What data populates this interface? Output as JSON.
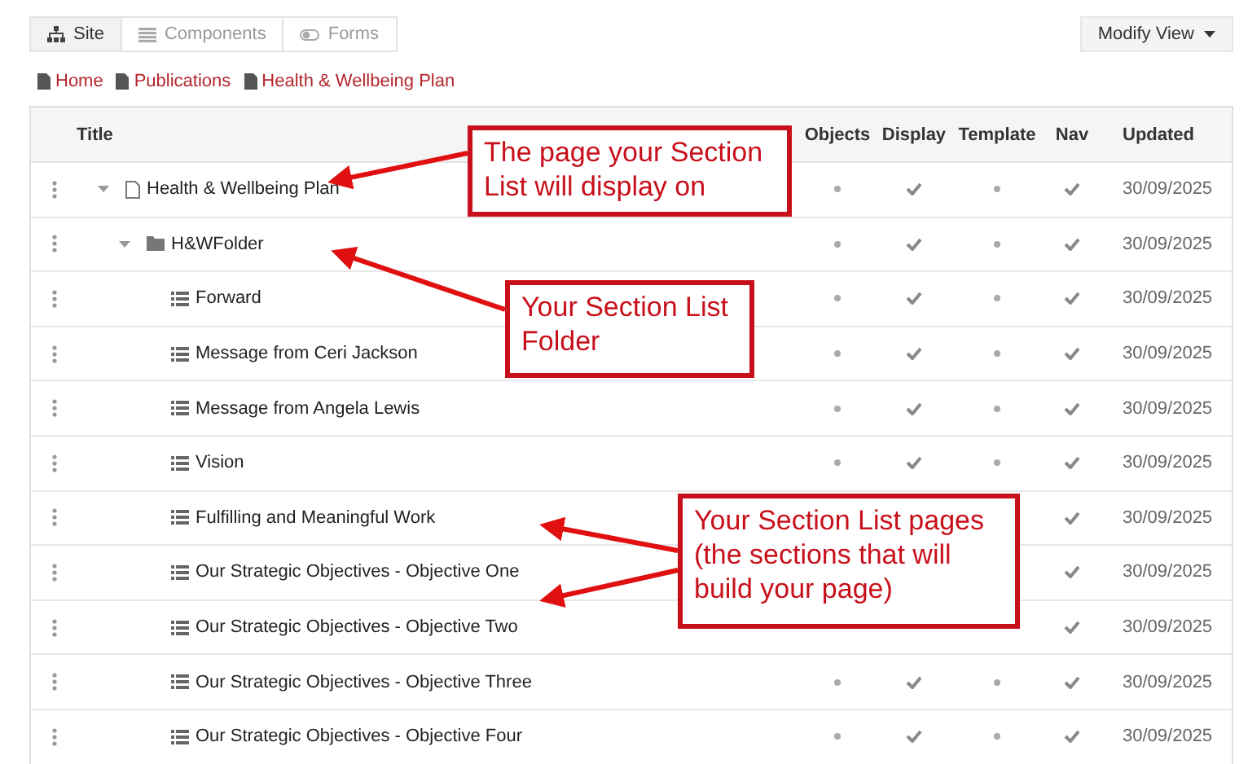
{
  "tabs": [
    {
      "label": "Site",
      "selected": true
    },
    {
      "label": "Components",
      "selected": false
    },
    {
      "label": "Forms",
      "selected": false
    }
  ],
  "modify_view": {
    "label": "Modify View"
  },
  "breadcrumbs": [
    "Home",
    "Publications",
    "Health & Wellbeing Plan"
  ],
  "table": {
    "columns": [
      "Title",
      "Objects",
      "Display",
      "Template",
      "Nav",
      "Updated"
    ],
    "rows": [
      {
        "title": "Health & Wellbeing Plan",
        "kind": "page",
        "expanded": true,
        "objects": false,
        "display": true,
        "template": false,
        "nav": true,
        "updated": "30/09/2025",
        "children": [
          {
            "title": "H&WFolder",
            "kind": "folder",
            "expanded": true,
            "objects": false,
            "display": true,
            "template": false,
            "nav": true,
            "updated": "30/09/2025",
            "children": [
              {
                "title": "Forward",
                "kind": "section",
                "objects": false,
                "display": true,
                "template": false,
                "nav": true,
                "updated": "30/09/2025"
              },
              {
                "title": "Message from Ceri Jackson",
                "kind": "section",
                "objects": false,
                "display": true,
                "template": false,
                "nav": true,
                "updated": "30/09/2025"
              },
              {
                "title": "Message from Angela Lewis",
                "kind": "section",
                "objects": false,
                "display": true,
                "template": false,
                "nav": true,
                "updated": "30/09/2025"
              },
              {
                "title": "Vision",
                "kind": "section",
                "objects": false,
                "display": true,
                "template": false,
                "nav": true,
                "updated": "30/09/2025"
              },
              {
                "title": "Fulfilling and Meaningful Work",
                "kind": "section",
                "nav": true,
                "updated": "30/09/2025"
              },
              {
                "title": "Our Strategic Objectives - Objective One",
                "kind": "section",
                "nav": true,
                "updated": "30/09/2025"
              },
              {
                "title": "Our Strategic Objectives - Objective Two",
                "kind": "section",
                "nav": true,
                "updated": "30/09/2025"
              },
              {
                "title": "Our Strategic Objectives - Objective Three",
                "kind": "section",
                "objects": false,
                "display": true,
                "template": false,
                "nav": true,
                "updated": "30/09/2025"
              },
              {
                "title": "Our Strategic Objectives - Objective Four",
                "kind": "section",
                "objects": false,
                "display": true,
                "template": false,
                "nav": true,
                "updated": "30/09/2025"
              }
            ]
          }
        ]
      }
    ]
  },
  "callouts": [
    {
      "text": "The page your Section\nList will display on"
    },
    {
      "text": "Your Section List\nFolder"
    },
    {
      "text": "Your Section List pages\n(the sections that will\nbuild your page)"
    }
  ]
}
